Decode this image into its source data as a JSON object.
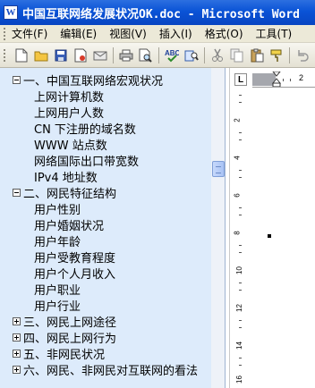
{
  "window": {
    "title": "中国互联网络发展状况OK.doc - Microsoft Word",
    "app_icon": "W"
  },
  "menu": {
    "items": [
      "文件(F)",
      "编辑(E)",
      "视图(V)",
      "插入(I)",
      "格式(O)",
      "工具(T)"
    ]
  },
  "toolbar": {
    "icons": [
      "new-document-icon",
      "open-folder-icon",
      "save-icon",
      "permission-icon",
      "email-icon",
      "print-icon",
      "print-preview-icon",
      "spelling-icon",
      "research-icon",
      "cut-icon",
      "copy-icon",
      "paste-icon",
      "format-painter-icon",
      "undo-icon"
    ]
  },
  "document_map": {
    "sections": [
      {
        "label": "一、中国互联网络宏观状况",
        "expanded": true,
        "children": [
          "上网计算机数",
          "上网用户人数",
          "CN 下注册的域名数",
          "WWW  站点数",
          "网络国际出口带宽数",
          "IPv4  地址数"
        ]
      },
      {
        "label": "二、网民特征结构",
        "expanded": true,
        "children": [
          "用户性别",
          "用户婚姻状况",
          "用户年龄",
          "用户受教育程度",
          "用户个人月收入",
          "用户职业",
          "用户行业"
        ]
      },
      {
        "label": "三、网民上网途径",
        "expanded": false,
        "children": []
      },
      {
        "label": "四、网民上网行为",
        "expanded": false,
        "children": []
      },
      {
        "label": "五、非网民状况",
        "expanded": false,
        "children": []
      },
      {
        "label": "六、网民、非网民对互联网的看法",
        "expanded": false,
        "children": []
      }
    ]
  },
  "ruler": {
    "tab_selector": "L",
    "horizontal_number": "2",
    "vertical_numbers": [
      "2",
      "4",
      "6",
      "8",
      "10",
      "12",
      "14",
      "16"
    ]
  },
  "colors": {
    "titlebar": "#0a53d6",
    "document_map_bg": "#ddebfb",
    "chrome": "#ece9d8"
  }
}
